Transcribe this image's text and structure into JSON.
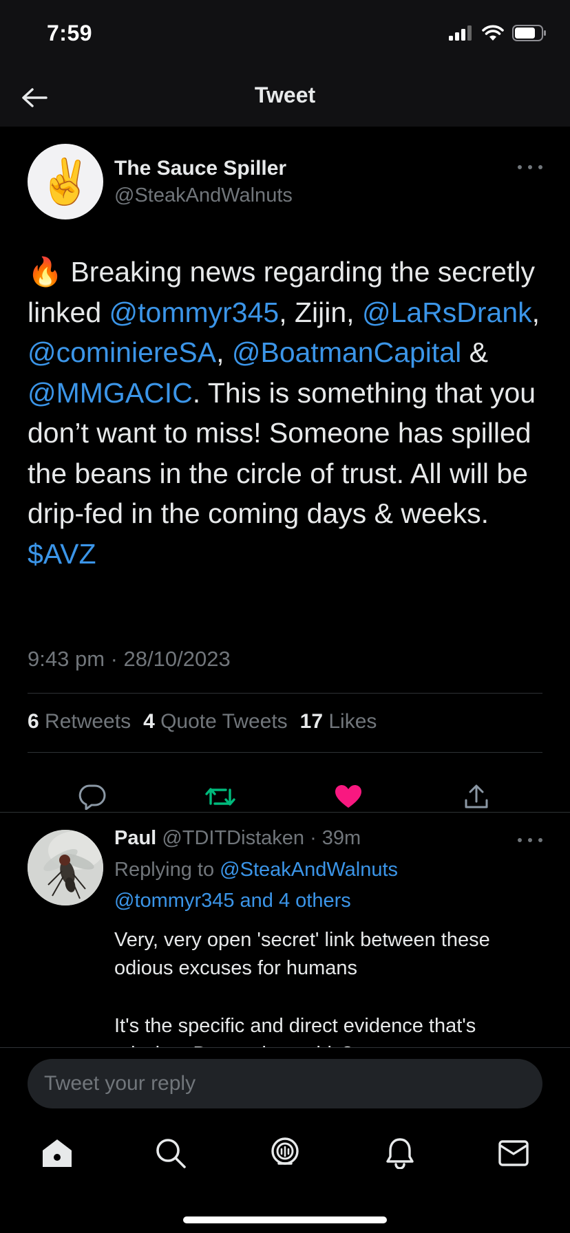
{
  "status_bar": {
    "time": "7:59"
  },
  "nav": {
    "title": "Tweet"
  },
  "tweet": {
    "avatar_emoji": "✌️",
    "author_name": "The Sauce Spiller",
    "author_handle": "@SteakAndWalnuts",
    "body": {
      "fire_emoji": "🔥",
      "t1": " Breaking news regarding the secretly linked ",
      "m1": "@tommyr345",
      "t2": ", Zijin, ",
      "m2": "@LaRsDrank",
      "t3": ", ",
      "m3": "@cominiereSA",
      "t4": ", ",
      "m4": "@BoatmanCapital",
      "t5": " & ",
      "m5": "@MMGACIC",
      "t6": ". This is something that you don’t want to miss! Someone has spilled the beans in the circle of trust. All will be drip-fed in the coming days & weeks. ",
      "m6": "$AVZ"
    },
    "timestamp": "9:43 pm · 28/10/2023",
    "stats": {
      "retweets_count": "6",
      "retweets_label": " Retweets",
      "quotes_count": "4",
      "quotes_label": " Quote Tweets",
      "likes_count": "17",
      "likes_label": " Likes"
    },
    "colors": {
      "like": "#f91880",
      "retweet": "#00ba7c",
      "link": "#3b95e8"
    }
  },
  "reply": {
    "name": "Paul",
    "handle": "@TDITDistaken",
    "time": " · 39m",
    "replying_to_label": "Replying to ",
    "replying_to_handle": "@SteakAndWalnuts",
    "replying_to_more": "@tommyr345 and 4 others",
    "text1": "Very, very open 'secret' link between these odious excuses for humans",
    "text2": "It's the specific and direct evidence that's",
    "text3": "missing. Do you have this?"
  },
  "compose": {
    "placeholder": "Tweet your reply"
  },
  "tabs": [
    "home-icon",
    "search-icon",
    "spaces-icon",
    "notifications-icon",
    "messages-icon"
  ]
}
